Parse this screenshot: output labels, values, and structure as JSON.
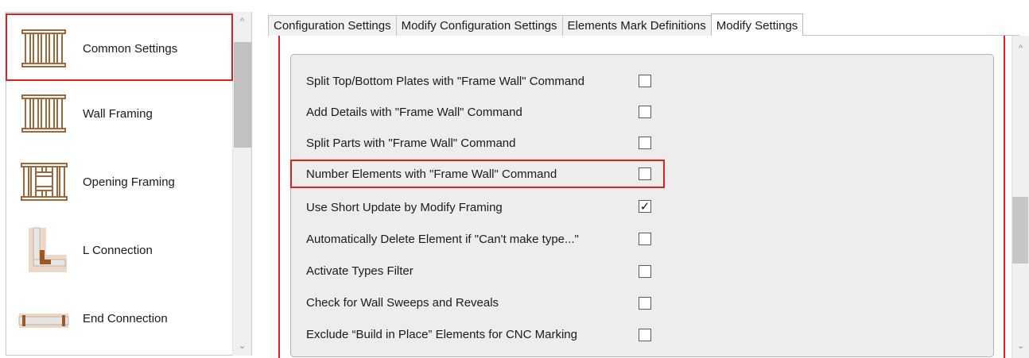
{
  "sidebar": {
    "items": [
      {
        "label": "Common Settings",
        "icon": "wall-studs-icon",
        "selected": true
      },
      {
        "label": "Wall Framing",
        "icon": "wall-studs-icon",
        "selected": false
      },
      {
        "label": "Opening Framing",
        "icon": "opening-frame-icon",
        "selected": false
      },
      {
        "label": "L Connection",
        "icon": "l-connection-icon",
        "selected": false
      },
      {
        "label": "End Connection",
        "icon": "end-connection-icon",
        "selected": false
      }
    ],
    "scroll_up": "^",
    "scroll_down": "⌄"
  },
  "tabs": [
    {
      "label": "Configuration Settings",
      "active": false
    },
    {
      "label": "Modify Configuration Settings",
      "active": false
    },
    {
      "label": "Elements Mark Definitions",
      "active": false
    },
    {
      "label": "Modify Settings",
      "active": true
    }
  ],
  "options": [
    {
      "label": "Split Top/Bottom Plates with \"Frame Wall\" Command",
      "checked": false
    },
    {
      "label": "Add Details with \"Frame Wall\" Command",
      "checked": false
    },
    {
      "label": "Split Parts with \"Frame Wall\" Command",
      "checked": false
    },
    {
      "label": "Number Elements with \"Frame Wall\" Command",
      "checked": false
    },
    {
      "label": "Use Short Update by Modify Framing",
      "checked": true
    },
    {
      "label": "Automatically Delete Element if \"Can't make type...\"",
      "checked": false
    },
    {
      "label": "Activate Types Filter",
      "checked": false
    },
    {
      "label": "Check for Wall Sweeps and Reveals",
      "checked": false
    },
    {
      "label": "Exclude “Build in Place” Elements for CNC Marking",
      "checked": false
    }
  ],
  "panel_scroll": {
    "up": "^",
    "down": "⌄"
  },
  "colors": {
    "highlight": "#e02020",
    "wood": "#a0673a",
    "panel_bg": "#ededed"
  }
}
